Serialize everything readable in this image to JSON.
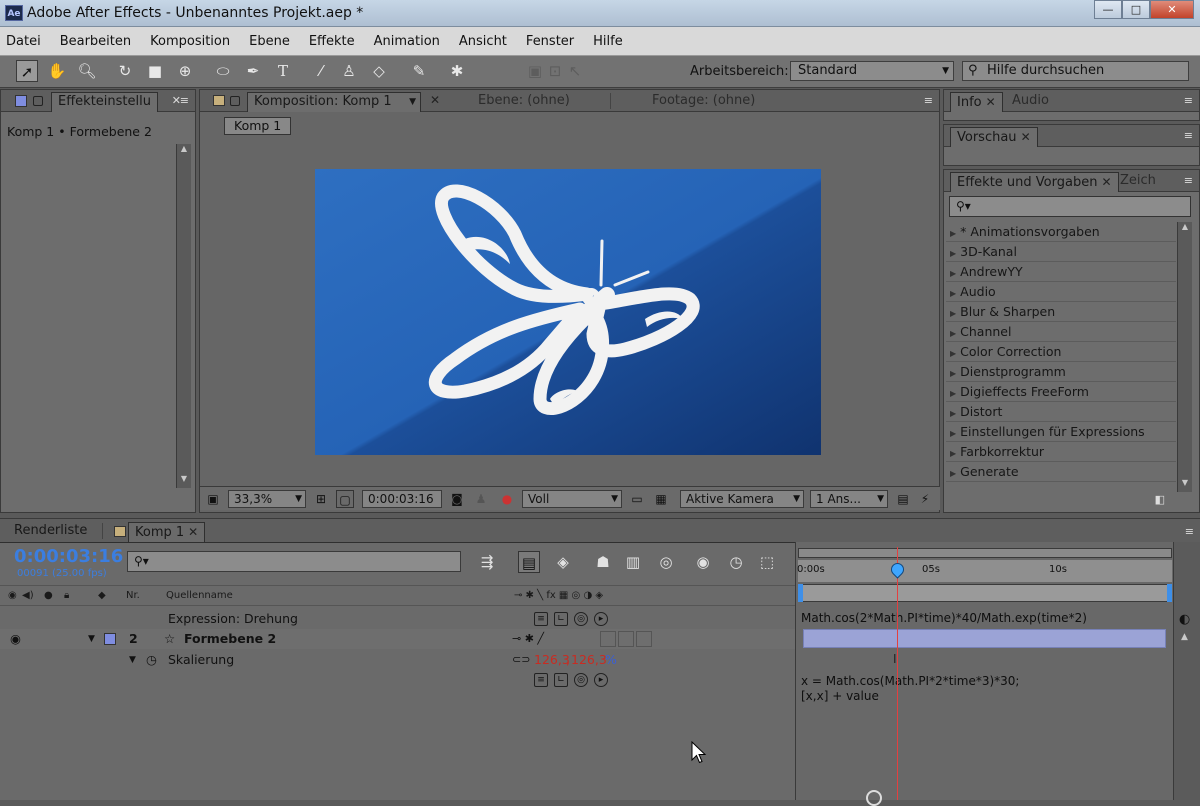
{
  "window": {
    "title": "Adobe After Effects - Unbenanntes Projekt.aep *",
    "app_icon": "Ae",
    "controls": [
      "—",
      "□",
      "✕"
    ]
  },
  "menu": [
    "Datei",
    "Bearbeiten",
    "Komposition",
    "Ebene",
    "Effekte",
    "Animation",
    "Ansicht",
    "Fenster",
    "Hilfe"
  ],
  "toolbar": {
    "tools": [
      "selection-tool-icon",
      "hand-tool-icon",
      "zoom-tool-icon",
      "rotate-tool-icon",
      "camera-tool-icon",
      "pan-behind-tool-icon",
      "ellipse-tool-icon",
      "pen-tool-icon",
      "text-tool-icon",
      "brush-tool-icon",
      "clone-stamp-tool-icon",
      "eraser-tool-icon",
      "roto-brush-tool-icon",
      "puppet-pin-tool-icon"
    ],
    "workspace_label": "Arbeitsbereich:",
    "workspace_value": "Standard",
    "help_search_placeholder": "Hilfe durchsuchen"
  },
  "effect_controls": {
    "tab": "Effekteinstellu",
    "breadcrumb": "Komp 1 • Formebene 2"
  },
  "composition": {
    "tabs": {
      "comp": "Komposition: Komp 1",
      "layer": "Ebene: (ohne)",
      "footage": "Footage: (ohne)"
    },
    "flow_button": "Komp 1",
    "viewer": {
      "zoom": "33,3%",
      "timecode": "0:00:03:16",
      "resolution": "Voll",
      "camera": "Aktive Kamera",
      "views": "1 Ans..."
    }
  },
  "info_panel": {
    "tabs": [
      "Info",
      "Audio"
    ]
  },
  "preview_panel": {
    "tab": "Vorschau"
  },
  "effects_presets": {
    "tabs": [
      "Effekte und Vorgaben",
      "Zeich"
    ],
    "search_value": "",
    "items": [
      "* Animationsvorgaben",
      "3D-Kanal",
      "AndrewYY",
      "Audio",
      "Blur & Sharpen",
      "Channel",
      "Color Correction",
      "Dienstprogramm",
      "Digieffects FreeForm",
      "Distort",
      "Einstellungen für Expressions",
      "Farbkorrektur",
      "Generate"
    ]
  },
  "timeline": {
    "tabs": [
      "Renderliste",
      "Komp 1"
    ],
    "timecode": "0:00:03:16",
    "frames": "00091 (25.00 fps)",
    "search_value": "",
    "columns": {
      "nr": "Nr.",
      "source": "Quellenname"
    },
    "ruler": [
      "0:00s",
      "05s",
      "10s"
    ],
    "rows": [
      {
        "name": "Expression: Drehung",
        "expr": "Math.cos(2*Math.PI*time)*40/Math.exp(time*2)"
      },
      {
        "num": "2",
        "name": "Formebene 2"
      },
      {
        "name": "Skalierung",
        "value_x": "126,3",
        "sep": ",",
        "value_y": "126,3",
        "unit": "%"
      },
      {
        "expr_line1": "x = Math.cos(Math.PI*2*time*3)*30;",
        "expr_line2": "[x,x] + value"
      }
    ]
  }
}
